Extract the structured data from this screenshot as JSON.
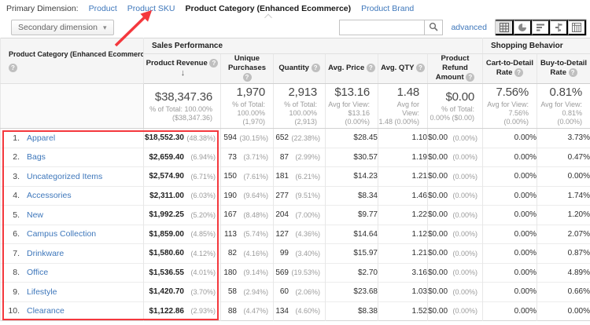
{
  "colors": {
    "link_blue": "#3e77bb",
    "annotation_red": "#f4383d",
    "header_bg": "#f5f5f5",
    "border_grey": "#d6d6d6"
  },
  "icons": {
    "help_glyph": "?",
    "sort_desc_glyph": "↓",
    "caret_glyph": "▾"
  },
  "primary_bar": {
    "label": "Primary Dimension:",
    "tabs": [
      {
        "label": "Product",
        "active": false
      },
      {
        "label": "Product SKU",
        "active": false
      },
      {
        "label": "Product Category (Enhanced Ecommerce)",
        "active": true
      },
      {
        "label": "Product Brand",
        "active": false
      }
    ]
  },
  "toolbar": {
    "secondary_button_label": "Secondary dimension",
    "search_value": "",
    "search_placeholder": "",
    "advanced_label": "advanced",
    "view_buttons": [
      {
        "name": "table-view",
        "selected": true
      },
      {
        "name": "percent-view",
        "selected": false
      },
      {
        "name": "performance-view",
        "selected": false
      },
      {
        "name": "comparison-view",
        "selected": false
      },
      {
        "name": "pivot-view",
        "selected": false
      }
    ]
  },
  "table": {
    "dimension_header": "Product Category (Enhanced Ecommerce)",
    "group_headers": {
      "sales": "Sales Performance",
      "shopping": "Shopping Behavior"
    },
    "columns": [
      {
        "line1": "Product Revenue",
        "line2": ""
      },
      {
        "line1": "Unique",
        "line2": "Purchases"
      },
      {
        "line1": "Quantity",
        "line2": ""
      },
      {
        "line1": "Avg. Price",
        "line2": ""
      },
      {
        "line1": "Avg. QTY",
        "line2": ""
      },
      {
        "line1": "Product Refund",
        "line2": "Amount"
      },
      {
        "line1": "Cart-to-Detail",
        "line2": "Rate"
      },
      {
        "line1": "Buy-to-Detail",
        "line2": "Rate"
      }
    ],
    "totals": [
      {
        "value": "$38,347.36",
        "sub": "% of Total: 100.00%\n($38,347.36)"
      },
      {
        "value": "1,970",
        "sub": "% of Total:\n100.00%\n(1,970)"
      },
      {
        "value": "2,913",
        "sub": "% of Total:\n100.00%\n(2,913)"
      },
      {
        "value": "$13.16",
        "sub": "Avg for View:\n$13.16 (0.00%)"
      },
      {
        "value": "1.48",
        "sub": "Avg for View:\n1.48 (0.00%)"
      },
      {
        "value": "$0.00",
        "sub": "% of Total:\n0.00% ($0.00)"
      },
      {
        "value": "7.56%",
        "sub": "Avg for View:\n7.56% (0.00%)"
      },
      {
        "value": "0.81%",
        "sub": "Avg for View:\n0.81% (0.00%)"
      }
    ],
    "rows": [
      {
        "rank": "1.",
        "category": "Apparel",
        "revenue": "$18,552.30",
        "revenue_pct": "(48.38%)",
        "unique": "594",
        "unique_pct": "(30.15%)",
        "qty": "652",
        "qty_pct": "(22.38%)",
        "avg_price": "$28.45",
        "avg_qty": "1.10",
        "refund": "$0.00",
        "refund_pct": "(0.00%)",
        "cart_rate": "0.00%",
        "buy_rate": "3.73%"
      },
      {
        "rank": "2.",
        "category": "Bags",
        "revenue": "$2,659.40",
        "revenue_pct": "(6.94%)",
        "unique": "73",
        "unique_pct": "(3.71%)",
        "qty": "87",
        "qty_pct": "(2.99%)",
        "avg_price": "$30.57",
        "avg_qty": "1.19",
        "refund": "$0.00",
        "refund_pct": "(0.00%)",
        "cart_rate": "0.00%",
        "buy_rate": "0.47%"
      },
      {
        "rank": "3.",
        "category": "Uncategorized Items",
        "revenue": "$2,574.90",
        "revenue_pct": "(6.71%)",
        "unique": "150",
        "unique_pct": "(7.61%)",
        "qty": "181",
        "qty_pct": "(6.21%)",
        "avg_price": "$14.23",
        "avg_qty": "1.21",
        "refund": "$0.00",
        "refund_pct": "(0.00%)",
        "cart_rate": "0.00%",
        "buy_rate": "0.00%"
      },
      {
        "rank": "4.",
        "category": "Accessories",
        "revenue": "$2,311.00",
        "revenue_pct": "(6.03%)",
        "unique": "190",
        "unique_pct": "(9.64%)",
        "qty": "277",
        "qty_pct": "(9.51%)",
        "avg_price": "$8.34",
        "avg_qty": "1.46",
        "refund": "$0.00",
        "refund_pct": "(0.00%)",
        "cart_rate": "0.00%",
        "buy_rate": "1.74%"
      },
      {
        "rank": "5.",
        "category": "New",
        "revenue": "$1,992.25",
        "revenue_pct": "(5.20%)",
        "unique": "167",
        "unique_pct": "(8.48%)",
        "qty": "204",
        "qty_pct": "(7.00%)",
        "avg_price": "$9.77",
        "avg_qty": "1.22",
        "refund": "$0.00",
        "refund_pct": "(0.00%)",
        "cart_rate": "0.00%",
        "buy_rate": "1.20%"
      },
      {
        "rank": "6.",
        "category": "Campus Collection",
        "revenue": "$1,859.00",
        "revenue_pct": "(4.85%)",
        "unique": "113",
        "unique_pct": "(5.74%)",
        "qty": "127",
        "qty_pct": "(4.36%)",
        "avg_price": "$14.64",
        "avg_qty": "1.12",
        "refund": "$0.00",
        "refund_pct": "(0.00%)",
        "cart_rate": "0.00%",
        "buy_rate": "2.07%"
      },
      {
        "rank": "7.",
        "category": "Drinkware",
        "revenue": "$1,580.60",
        "revenue_pct": "(4.12%)",
        "unique": "82",
        "unique_pct": "(4.16%)",
        "qty": "99",
        "qty_pct": "(3.40%)",
        "avg_price": "$15.97",
        "avg_qty": "1.21",
        "refund": "$0.00",
        "refund_pct": "(0.00%)",
        "cart_rate": "0.00%",
        "buy_rate": "0.87%"
      },
      {
        "rank": "8.",
        "category": "Office",
        "revenue": "$1,536.55",
        "revenue_pct": "(4.01%)",
        "unique": "180",
        "unique_pct": "(9.14%)",
        "qty": "569",
        "qty_pct": "(19.53%)",
        "avg_price": "$2.70",
        "avg_qty": "3.16",
        "refund": "$0.00",
        "refund_pct": "(0.00%)",
        "cart_rate": "0.00%",
        "buy_rate": "4.89%"
      },
      {
        "rank": "9.",
        "category": "Lifestyle",
        "revenue": "$1,420.70",
        "revenue_pct": "(3.70%)",
        "unique": "58",
        "unique_pct": "(2.94%)",
        "qty": "60",
        "qty_pct": "(2.06%)",
        "avg_price": "$23.68",
        "avg_qty": "1.03",
        "refund": "$0.00",
        "refund_pct": "(0.00%)",
        "cart_rate": "0.00%",
        "buy_rate": "0.66%"
      },
      {
        "rank": "10.",
        "category": "Clearance",
        "revenue": "$1,122.86",
        "revenue_pct": "(2.93%)",
        "unique": "88",
        "unique_pct": "(4.47%)",
        "qty": "134",
        "qty_pct": "(4.60%)",
        "avg_price": "$8.38",
        "avg_qty": "1.52",
        "refund": "$0.00",
        "refund_pct": "(0.00%)",
        "cart_rate": "0.00%",
        "buy_rate": "0.00%"
      }
    ]
  }
}
